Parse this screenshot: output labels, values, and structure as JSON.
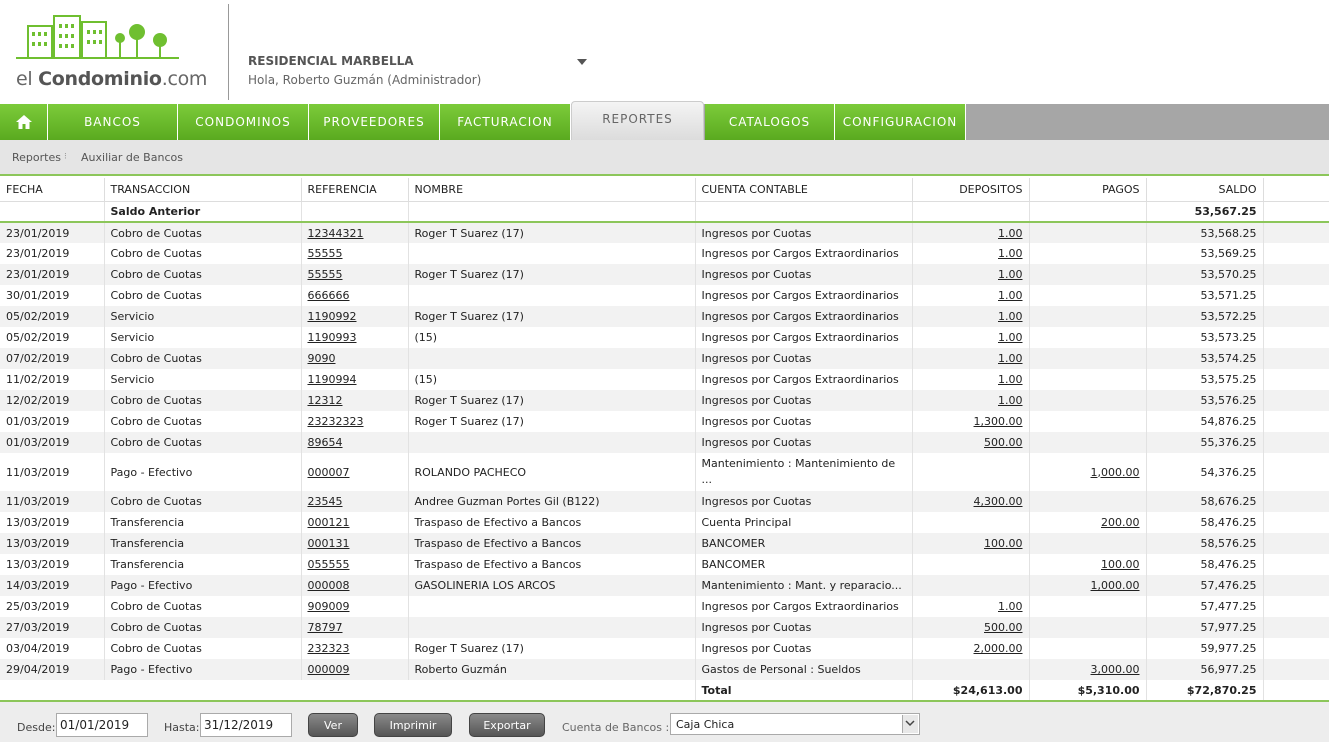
{
  "logo": {
    "prefix": "el ",
    "brand": "Condominio",
    "suffix": ".com"
  },
  "header": {
    "condo_name": "RESIDENCIAL MARBELLA",
    "greeting": "Hola, Roberto Guzmán (Administrador)"
  },
  "nav": {
    "items": [
      "BANCOS",
      "CONDOMINOS",
      "PROVEEDORES",
      "FACTURACION",
      "REPORTES",
      "CATALOGOS",
      "CONFIGURACION"
    ],
    "active": "REPORTES"
  },
  "breadcrumb": {
    "root": "Reportes",
    "current": "Auxiliar de Bancos"
  },
  "table": {
    "columns": [
      "FECHA",
      "TRANSACCION",
      "REFERENCIA",
      "NOMBRE",
      "CUENTA CONTABLE",
      "DEPOSITOS",
      "PAGOS",
      "SALDO"
    ],
    "previous_label": "Saldo Anterior",
    "previous_balance": "53,567.25",
    "rows": [
      [
        "23/01/2019",
        "Cobro de Cuotas",
        "12344321",
        "Roger T Suarez (17)",
        "Ingresos por Cuotas",
        "1.00",
        "",
        "53,568.25"
      ],
      [
        "23/01/2019",
        "Cobro de Cuotas",
        "55555",
        "",
        "Ingresos por Cargos Extraordinarios",
        "1.00",
        "",
        "53,569.25"
      ],
      [
        "23/01/2019",
        "Cobro de Cuotas",
        "55555",
        "Roger T Suarez (17)",
        "Ingresos por Cuotas",
        "1.00",
        "",
        "53,570.25"
      ],
      [
        "30/01/2019",
        "Cobro de Cuotas",
        "666666",
        "",
        "Ingresos por Cargos Extraordinarios",
        "1.00",
        "",
        "53,571.25"
      ],
      [
        "05/02/2019",
        "Servicio",
        "1190992",
        "Roger T Suarez (17)",
        "Ingresos por Cargos Extraordinarios",
        "1.00",
        "",
        "53,572.25"
      ],
      [
        "05/02/2019",
        "Servicio",
        "1190993",
        "(15)",
        "Ingresos por Cargos Extraordinarios",
        "1.00",
        "",
        "53,573.25"
      ],
      [
        "07/02/2019",
        "Cobro de Cuotas",
        "9090",
        "",
        "Ingresos por Cuotas",
        "1.00",
        "",
        "53,574.25"
      ],
      [
        "11/02/2019",
        "Servicio",
        "1190994",
        "(15)",
        "Ingresos por Cargos Extraordinarios",
        "1.00",
        "",
        "53,575.25"
      ],
      [
        "12/02/2019",
        "Cobro de Cuotas",
        "12312",
        "Roger T Suarez (17)",
        "Ingresos por Cuotas",
        "1.00",
        "",
        "53,576.25"
      ],
      [
        "01/03/2019",
        "Cobro de Cuotas",
        "23232323",
        "Roger T Suarez (17)",
        "Ingresos por Cuotas",
        "1,300.00",
        "",
        "54,876.25"
      ],
      [
        "01/03/2019",
        "Cobro de Cuotas",
        "89654",
        "",
        "Ingresos por Cuotas",
        "500.00",
        "",
        "55,376.25"
      ],
      [
        "11/03/2019",
        "Pago - Efectivo",
        "000007",
        "ROLANDO PACHECO",
        "Mantenimiento : Mantenimiento de ...",
        "",
        "1,000.00",
        "54,376.25"
      ],
      [
        "11/03/2019",
        "Cobro de Cuotas",
        "23545",
        "Andree Guzman Portes Gil (B122)",
        "Ingresos por Cuotas",
        "4,300.00",
        "",
        "58,676.25"
      ],
      [
        "13/03/2019",
        "Transferencia",
        "000121",
        "Traspaso de Efectivo a Bancos",
        "Cuenta Principal",
        "",
        "200.00",
        "58,476.25"
      ],
      [
        "13/03/2019",
        "Transferencia",
        "000131",
        "Traspaso de Efectivo a Bancos",
        "BANCOMER",
        "100.00",
        "",
        "58,576.25"
      ],
      [
        "13/03/2019",
        "Transferencia",
        "055555",
        "Traspaso de Efectivo a Bancos",
        "BANCOMER",
        "",
        "100.00",
        "58,476.25"
      ],
      [
        "14/03/2019",
        "Pago - Efectivo",
        "000008",
        "GASOLINERIA LOS ARCOS",
        "Mantenimiento : Mant. y reparacio...",
        "",
        "1,000.00",
        "57,476.25"
      ],
      [
        "25/03/2019",
        "Cobro de Cuotas",
        "909009",
        "",
        "Ingresos por Cargos Extraordinarios",
        "1.00",
        "",
        "57,477.25"
      ],
      [
        "27/03/2019",
        "Cobro de Cuotas",
        "78797",
        "",
        "Ingresos por Cuotas",
        "500.00",
        "",
        "57,977.25"
      ],
      [
        "03/04/2019",
        "Cobro de Cuotas",
        "232323",
        "Roger T Suarez (17)",
        "Ingresos por Cuotas",
        "2,000.00",
        "",
        "59,977.25"
      ],
      [
        "29/04/2019",
        "Pago - Efectivo",
        "000009",
        "Roberto Guzmán",
        "Gastos de Personal : Sueldos",
        "",
        "3,000.00",
        "56,977.25"
      ]
    ],
    "total": {
      "label": "Total",
      "depositos": "$24,613.00",
      "pagos": "$5,310.00",
      "saldo": "$72,870.25"
    }
  },
  "footer": {
    "desde_label": "Desde:",
    "desde_value": "01/01/2019",
    "hasta_label": "Hasta:",
    "hasta_value": "31/12/2019",
    "ver_label": "Ver",
    "imprimir_label": "Imprimir",
    "exportar_label": "Exportar",
    "cuenta_label": "Cuenta de Bancos :",
    "cuenta_value": "Caja Chica"
  },
  "colors": {
    "brand_green": "#6fbf30",
    "nav_gray": "#a6a6a6",
    "accent_line": "#8cc65a"
  },
  "icons": {
    "home": "home-icon",
    "dropdown": "chevron-down-icon"
  }
}
